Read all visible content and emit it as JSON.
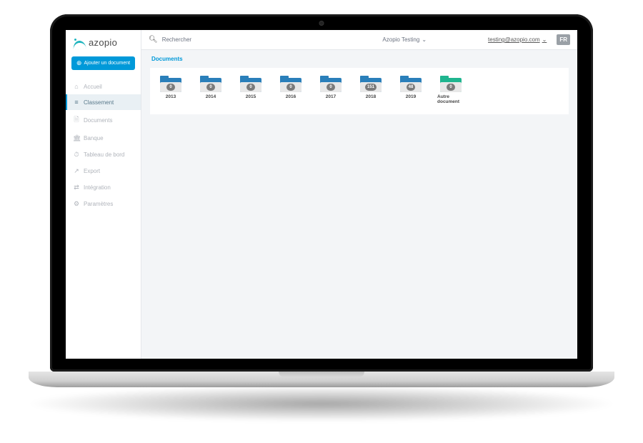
{
  "logo_text": "azopio",
  "add_doc_label": "Ajouter un document",
  "sidebar": {
    "items": [
      {
        "icon": "home-icon",
        "glyph": "⌂",
        "label": "Accueil"
      },
      {
        "icon": "list-icon",
        "glyph": "≡",
        "label": "Classement",
        "active": true
      },
      {
        "icon": "file-icon",
        "glyph": "🗎",
        "label": "Documents"
      },
      {
        "icon": "bank-icon",
        "glyph": "🏛",
        "label": "Banque"
      },
      {
        "icon": "gauge-icon",
        "glyph": "⏱",
        "label": "Tableau de bord"
      },
      {
        "icon": "export-icon",
        "glyph": "↗",
        "label": "Export"
      },
      {
        "icon": "link-icon",
        "glyph": "⇄",
        "label": "Intégration"
      },
      {
        "icon": "gear-icon",
        "glyph": "⚙",
        "label": "Paramètres"
      }
    ]
  },
  "search": {
    "placeholder": "Rechercher"
  },
  "header": {
    "account_name": "Azopio Testing",
    "user_email": "testing@azopio.com",
    "lang": "FR"
  },
  "breadcrumb": "Documents",
  "folders": [
    {
      "label": "2013",
      "count": "0",
      "variant": "blue"
    },
    {
      "label": "2014",
      "count": "0",
      "variant": "blue"
    },
    {
      "label": "2015",
      "count": "0",
      "variant": "blue"
    },
    {
      "label": "2016",
      "count": "0",
      "variant": "blue"
    },
    {
      "label": "2017",
      "count": "0",
      "variant": "blue"
    },
    {
      "label": "2018",
      "count": "151",
      "variant": "blue"
    },
    {
      "label": "2019",
      "count": "48",
      "variant": "blue"
    },
    {
      "label": "Autre document",
      "count": "0",
      "variant": "green"
    }
  ]
}
